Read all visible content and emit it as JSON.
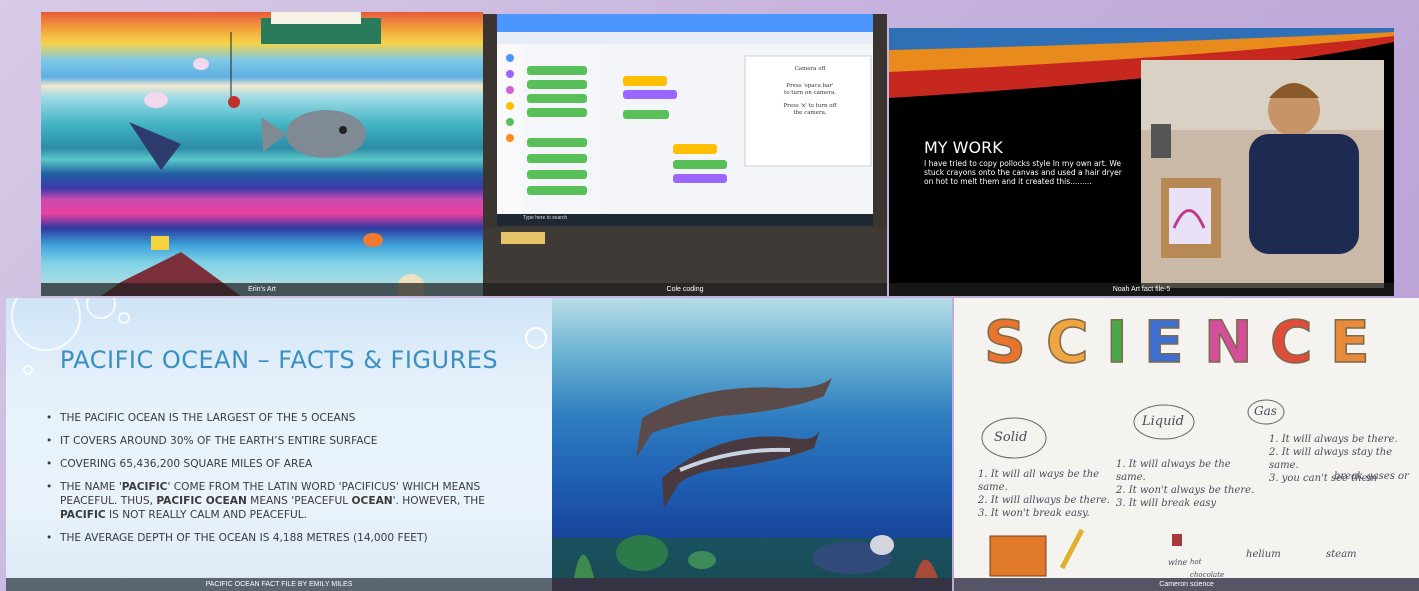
{
  "tiles": {
    "erin": {
      "caption": "Erin's Art"
    },
    "cole": {
      "caption": "Cole coding",
      "screen_text": {
        "l1": "Camera off",
        "l2": "Press 'space bar'",
        "l3": "to turn on camera.",
        "l4": "Press 'x' to turn off",
        "l5": "the camera."
      },
      "taskbar_search": "Type here to search"
    },
    "noah": {
      "caption": "Noah Art fact file-5",
      "title": "MY WORK",
      "body": "I have tried to copy pollocks style In my own art. We stuck crayons onto the canvas and used a hair dryer on hot to melt them and it created this........."
    },
    "pacific": {
      "title": "PACIFIC OCEAN – FACTS & FIGURES",
      "b1": "THE PACIFIC OCEAN IS THE LARGEST OF THE 5 OCEANS",
      "b2": "IT COVERS AROUND 30% OF THE EARTH’S ENTIRE SURFACE",
      "b3": "COVERING 65,436,200 SQUARE MILES OF AREA",
      "b4_a": "THE NAME '",
      "b4_b": "PACIFIC",
      "b4_c": "' COME FROM THE LATIN WORD 'PACIFICUS' WHICH MEANS PEACEFUL. THUS, ",
      "b4_d": "PACIFIC OCEAN",
      "b4_e": " MEANS 'PEACEFUL ",
      "b4_f": "OCEAN",
      "b4_g": "'. HOWEVER, THE ",
      "b4_h": "PACIFIC",
      "b4_i": " IS NOT REALLY CALM AND PEACEFUL.",
      "b5": "THE AVERAGE DEPTH OF THE OCEAN IS 4,188 METRES (14,000 FEET)",
      "caption": "PACIFIC OCEAN FACT FILE BY EMILY MILES"
    },
    "dolphins": {
      "caption": ""
    },
    "science": {
      "letters": [
        "S",
        "C",
        "I",
        "E",
        "N",
        "C",
        "E"
      ],
      "letter_colors": [
        "#e8742e",
        "#f0a640",
        "#4aa84a",
        "#3c6fd0",
        "#d34f9a",
        "#e04c3a",
        "#e98a3b"
      ],
      "solid_label": "Solid",
      "liquid_label": "Liquid",
      "gas_label": "Gas",
      "solid_notes": "1. It will all ways be the same.\n2. It will allways be there.\n3. It won't break easy.",
      "liquid_notes": "1. It will always be the same.\n2. It won't always be there.\n3. It will break easy",
      "gas_notes": "1. It will always be there.\n2. It will always stay the same.\n3. you can't see them",
      "extra": "break gases or",
      "helium": "helium",
      "steam": "steam",
      "wine": "wine",
      "hot_choc": "hot chocolate",
      "caption": "Cameron science"
    }
  },
  "colors": {
    "slide_title": "#3a8fc2",
    "caption_bg": "#1e1e1e"
  }
}
